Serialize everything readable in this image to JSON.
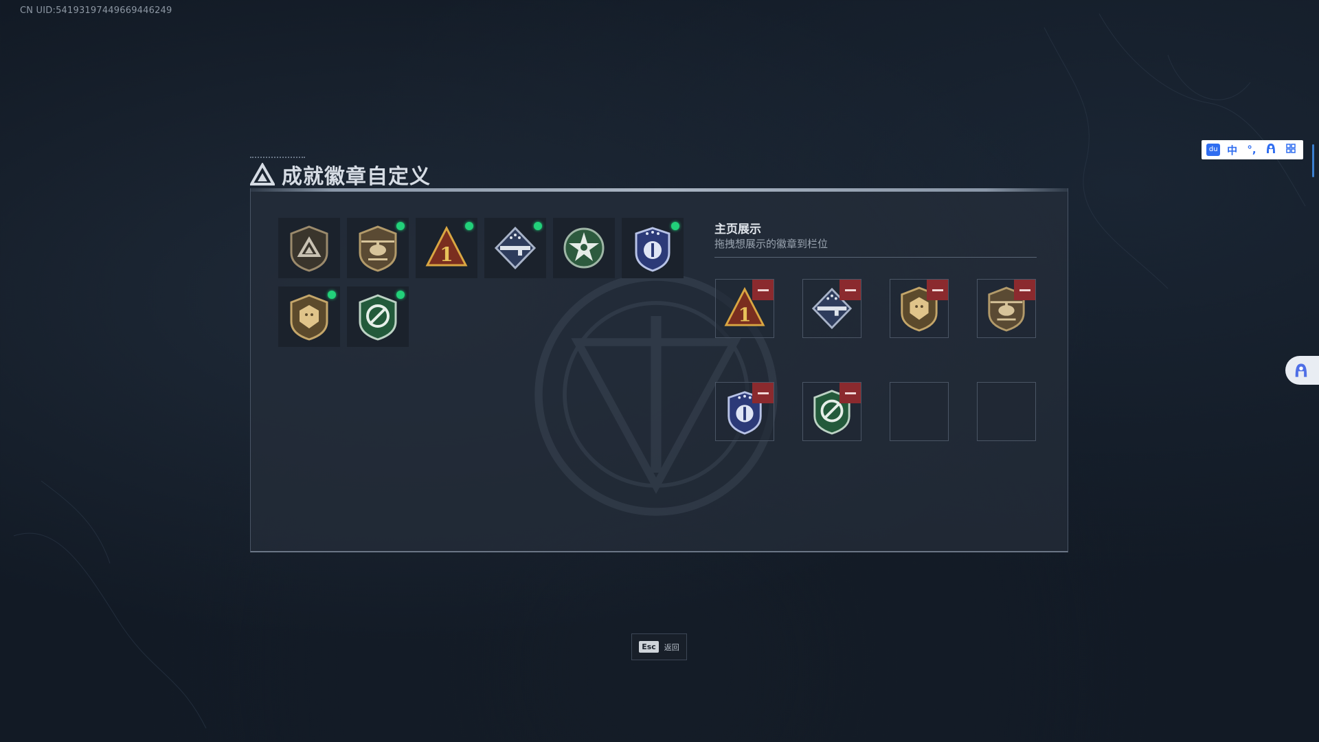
{
  "uid_text": "CN UID:5419319744966944624​9",
  "title": "成就徽章自定义",
  "display": {
    "heading": "主页展示",
    "subtitle": "拖拽想展示的徽章到栏位"
  },
  "owned_badges": [
    {
      "icon": "triangle-shield-badge-icon",
      "new": false
    },
    {
      "icon": "helicopter-badge-icon",
      "new": true
    },
    {
      "icon": "rank-one-badge-icon",
      "new": true
    },
    {
      "icon": "rifle-diamond-badge-icon",
      "new": true
    },
    {
      "icon": "green-star-badge-icon",
      "new": false
    },
    {
      "icon": "blue-eagle-badge-icon",
      "new": true
    },
    {
      "icon": "lion-shield-badge-icon",
      "new": true
    },
    {
      "icon": "green-wrench-badge-icon",
      "new": true
    }
  ],
  "display_slots": [
    {
      "icon": "rank-one-badge-icon",
      "filled": true
    },
    {
      "icon": "rifle-diamond-badge-icon",
      "filled": true
    },
    {
      "icon": "lion-shield-badge-icon",
      "filled": true
    },
    {
      "icon": "helicopter-badge-icon",
      "filled": true
    },
    {
      "icon": "blue-eagle-badge-icon",
      "filled": true
    },
    {
      "icon": "green-wrench-badge-icon",
      "filled": true
    },
    {
      "icon": "",
      "filled": false
    },
    {
      "icon": "",
      "filled": false
    }
  ],
  "esc": {
    "key": "Esc",
    "label": "返回"
  },
  "ime": {
    "logo": "du",
    "lang": "中",
    "punct": "°,",
    "tools_icon": "grid-icon"
  },
  "colors": {
    "new_dot": "#22d17a",
    "remove": "#8b2a2e",
    "accent_blue": "#2f6df0"
  }
}
